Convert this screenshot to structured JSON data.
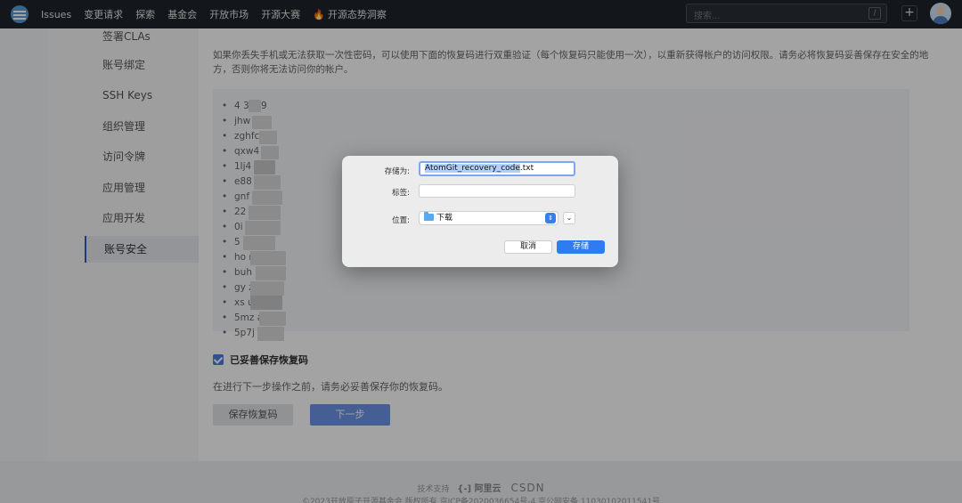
{
  "nav": {
    "items": [
      "Issues",
      "变更请求",
      "探索",
      "基金会",
      "开放市场",
      "开源大赛"
    ],
    "insight": "开源态势洞察",
    "search_placeholder": "搜索...",
    "slash_key": "/",
    "plus": "+"
  },
  "sidebar": {
    "items": [
      "签署CLAs",
      "账号绑定",
      "SSH Keys",
      "组织管理",
      "访问令牌",
      "应用管理",
      "应用开发",
      "账号安全"
    ],
    "active_index": 7
  },
  "main": {
    "description": "如果你丢失手机或无法获取一次性密码，可以使用下面的恢复码进行双重验证（每个恢复码只能使用一次），以重新获得帐户的访问权限。请务必将恢复码妥善保存在安全的地方，否则你将无法访问你的帐户。",
    "codes": [
      "4     3p79",
      "jhw    9",
      "zghfc    1",
      "qxw4    q5",
      "1lj4     o",
      "e88     v",
      "gnf     g",
      "22     3n",
      "0i     f1",
      "5     wqi",
      "ho     rxr",
      "buh     2v",
      "gy     z2",
      "xs     ug6",
      "5mz     a5i",
      "5p7j     8v"
    ],
    "checkbox_label": "已妥善保存恢复码",
    "checkbox_checked": true,
    "notice": "在进行下一步操作之前，请务必妥善保存你的恢复码。",
    "save_button": "保存恢复码",
    "next_button": "下一步"
  },
  "footer": {
    "tech_support": "技术支持",
    "aliyun": "阿里云",
    "csdn": "CSDN",
    "copyright": "©2023开放原子开源基金会 版权所有  京ICP备2020036654号-4  京公网安备 11030102011541号"
  },
  "dialog": {
    "save_as_label": "存储为:",
    "filename_selected": "AtomGit_recovery_code",
    "filename_ext": ".txt",
    "tags_label": "标签:",
    "tags_value": "",
    "location_label": "位置:",
    "location_value": "下载",
    "cancel_button": "取消",
    "save_button": "存储"
  }
}
